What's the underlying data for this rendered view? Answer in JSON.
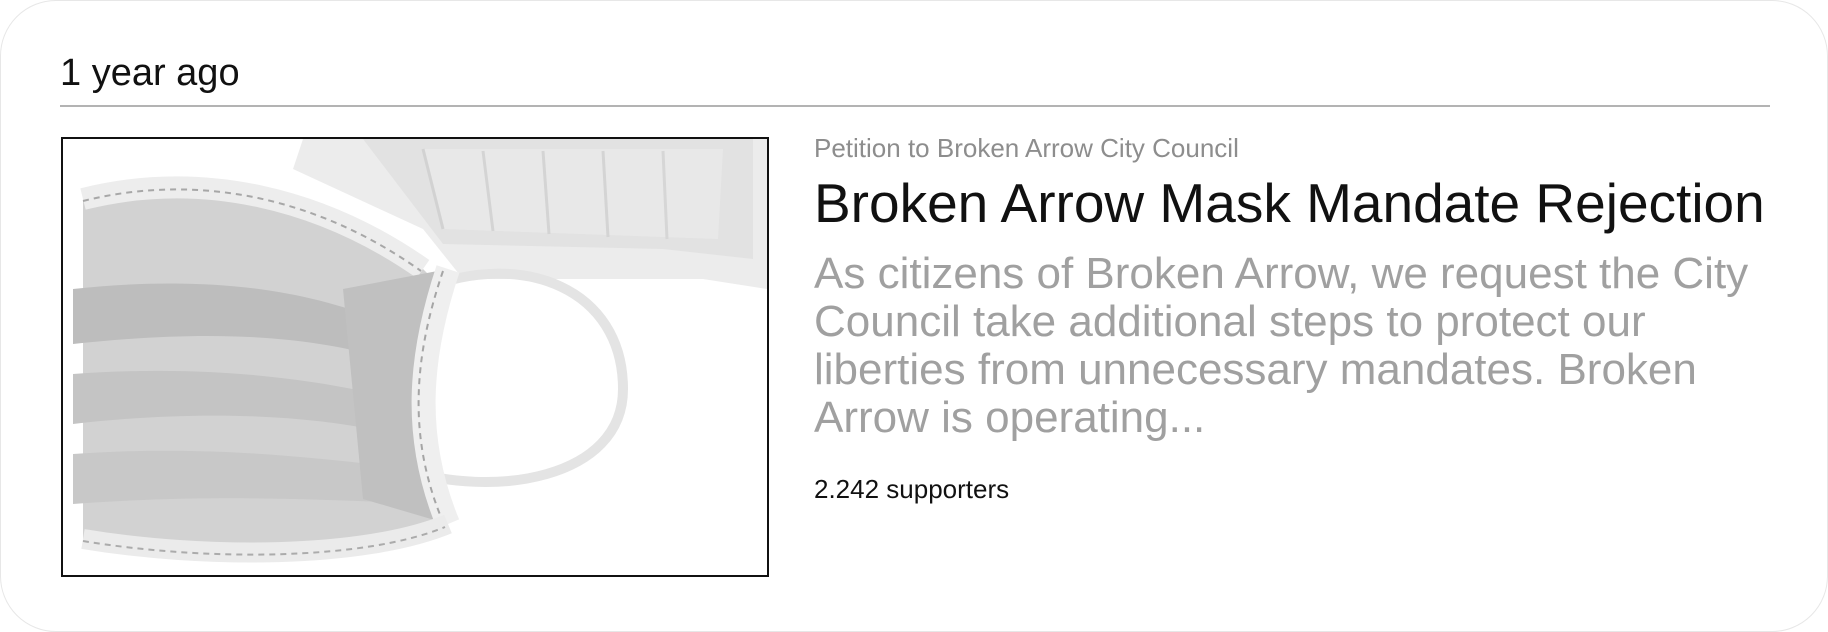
{
  "card": {
    "timestamp": "1 year ago",
    "image": {
      "alt": "Surgical face masks"
    },
    "petition": {
      "recipient": "Petition to Broken Arrow City Council",
      "title": "Broken Arrow Mask Mandate Rejection",
      "description": "As citizens of Broken Arrow, we request the City Council take additional steps to protect our liberties from unnecessary mandates. Broken Arrow is operating...",
      "supporters": "2.242 supporters"
    }
  }
}
